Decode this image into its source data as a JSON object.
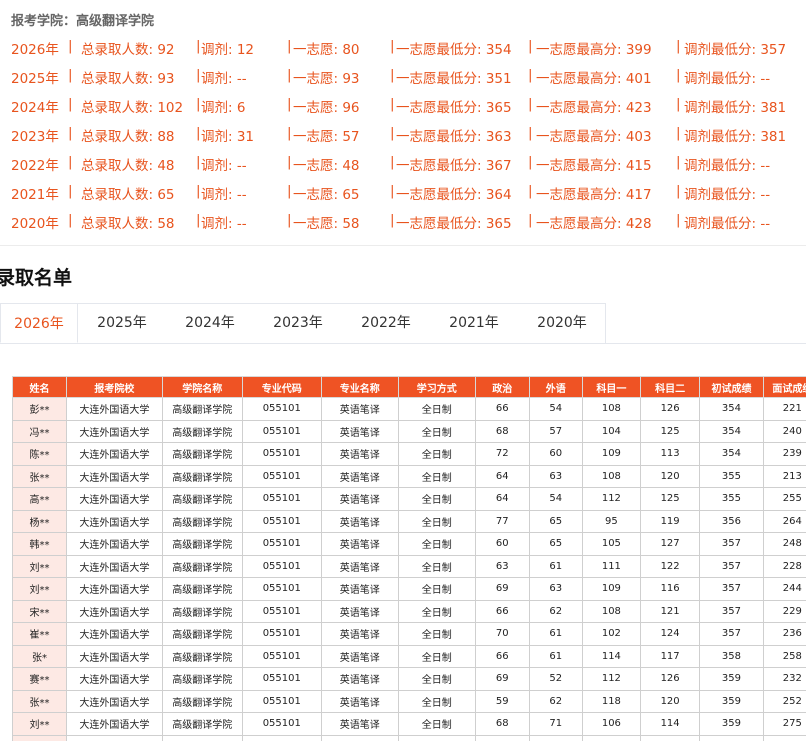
{
  "school_label": "报考学院：高级翻译学院",
  "stats": [
    {
      "year": "2026年",
      "total": "总录取人数: 92",
      "adjust": "调剂: 12",
      "first": "一志愿: 80",
      "first_min": "一志愿最低分: 354",
      "first_max": "一志愿最高分: 399",
      "adjust_min": "调剂最低分: 357"
    },
    {
      "year": "2025年",
      "total": "总录取人数: 93",
      "adjust": "调剂: --",
      "first": "一志愿: 93",
      "first_min": "一志愿最低分: 351",
      "first_max": "一志愿最高分: 401",
      "adjust_min": "调剂最低分: --"
    },
    {
      "year": "2024年",
      "total": "总录取人数: 102",
      "adjust": "调剂: 6",
      "first": "一志愿: 96",
      "first_min": "一志愿最低分: 365",
      "first_max": "一志愿最高分: 423",
      "adjust_min": "调剂最低分: 381"
    },
    {
      "year": "2023年",
      "total": "总录取人数: 88",
      "adjust": "调剂: 31",
      "first": "一志愿: 57",
      "first_min": "一志愿最低分: 363",
      "first_max": "一志愿最高分: 403",
      "adjust_min": "调剂最低分: 381"
    },
    {
      "year": "2022年",
      "total": "总录取人数: 48",
      "adjust": "调剂: --",
      "first": "一志愿: 48",
      "first_min": "一志愿最低分: 367",
      "first_max": "一志愿最高分: 415",
      "adjust_min": "调剂最低分: --"
    },
    {
      "year": "2021年",
      "total": "总录取人数: 65",
      "adjust": "调剂: --",
      "first": "一志愿: 65",
      "first_min": "一志愿最低分: 364",
      "first_max": "一志愿最高分: 417",
      "adjust_min": "调剂最低分: --"
    },
    {
      "year": "2020年",
      "total": "总录取人数: 58",
      "adjust": "调剂: --",
      "first": "一志愿: 58",
      "first_min": "一志愿最低分: 365",
      "first_max": "一志愿最高分: 428",
      "adjust_min": "调剂最低分: --"
    }
  ],
  "separator": "|",
  "section_title": "录取名单",
  "tabs": [
    "2026年",
    "2025年",
    "2024年",
    "2023年",
    "2022年",
    "2021年",
    "2020年"
  ],
  "active_tab": "2026年",
  "colors": {
    "accent": "#e8541e",
    "header_bg": "#ef5324",
    "name_cell_bg": "#fde9e4"
  },
  "table": {
    "columns": [
      "姓名",
      "报考院校",
      "学院名称",
      "专业代码",
      "专业名称",
      "学习方式",
      "政治",
      "外语",
      "科目一",
      "科目二",
      "初试成绩",
      "面试成绩"
    ],
    "rows": [
      [
        "彭**",
        "大连外国语大学",
        "高级翻译学院",
        "055101",
        "英语笔译",
        "全日制",
        "66",
        "54",
        "108",
        "126",
        "354",
        "221"
      ],
      [
        "冯**",
        "大连外国语大学",
        "高级翻译学院",
        "055101",
        "英语笔译",
        "全日制",
        "68",
        "57",
        "104",
        "125",
        "354",
        "240"
      ],
      [
        "陈**",
        "大连外国语大学",
        "高级翻译学院",
        "055101",
        "英语笔译",
        "全日制",
        "72",
        "60",
        "109",
        "113",
        "354",
        "239"
      ],
      [
        "张**",
        "大连外国语大学",
        "高级翻译学院",
        "055101",
        "英语笔译",
        "全日制",
        "64",
        "63",
        "108",
        "120",
        "355",
        "213"
      ],
      [
        "高**",
        "大连外国语大学",
        "高级翻译学院",
        "055101",
        "英语笔译",
        "全日制",
        "64",
        "54",
        "112",
        "125",
        "355",
        "255"
      ],
      [
        "杨**",
        "大连外国语大学",
        "高级翻译学院",
        "055101",
        "英语笔译",
        "全日制",
        "77",
        "65",
        "95",
        "119",
        "356",
        "264"
      ],
      [
        "韩**",
        "大连外国语大学",
        "高级翻译学院",
        "055101",
        "英语笔译",
        "全日制",
        "60",
        "65",
        "105",
        "127",
        "357",
        "248"
      ],
      [
        "刘**",
        "大连外国语大学",
        "高级翻译学院",
        "055101",
        "英语笔译",
        "全日制",
        "63",
        "61",
        "111",
        "122",
        "357",
        "228"
      ],
      [
        "刘**",
        "大连外国语大学",
        "高级翻译学院",
        "055101",
        "英语笔译",
        "全日制",
        "69",
        "63",
        "109",
        "116",
        "357",
        "244"
      ],
      [
        "宋**",
        "大连外国语大学",
        "高级翻译学院",
        "055101",
        "英语笔译",
        "全日制",
        "66",
        "62",
        "108",
        "121",
        "357",
        "229"
      ],
      [
        "崔**",
        "大连外国语大学",
        "高级翻译学院",
        "055101",
        "英语笔译",
        "全日制",
        "70",
        "61",
        "102",
        "124",
        "357",
        "236"
      ],
      [
        "张*",
        "大连外国语大学",
        "高级翻译学院",
        "055101",
        "英语笔译",
        "全日制",
        "66",
        "61",
        "114",
        "117",
        "358",
        "258"
      ],
      [
        "赛**",
        "大连外国语大学",
        "高级翻译学院",
        "055101",
        "英语笔译",
        "全日制",
        "69",
        "52",
        "112",
        "126",
        "359",
        "232"
      ],
      [
        "张**",
        "大连外国语大学",
        "高级翻译学院",
        "055101",
        "英语笔译",
        "全日制",
        "59",
        "62",
        "118",
        "120",
        "359",
        "252"
      ],
      [
        "刘**",
        "大连外国语大学",
        "高级翻译学院",
        "055101",
        "英语笔译",
        "全日制",
        "68",
        "71",
        "106",
        "114",
        "359",
        "275"
      ],
      [
        "王*",
        "大连外国语大学",
        "高级翻译学院",
        "055101",
        "英语笔译",
        "全日制",
        "69",
        "61",
        "114",
        "115",
        "359",
        "237"
      ]
    ]
  }
}
